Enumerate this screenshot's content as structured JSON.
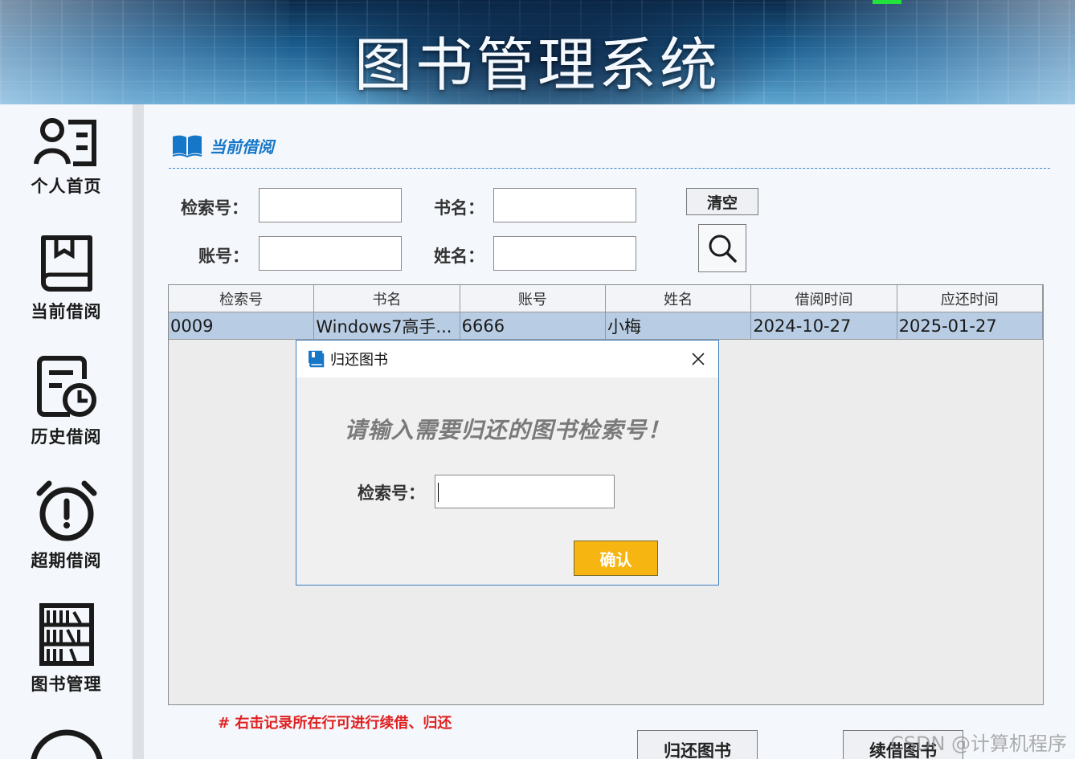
{
  "app": {
    "title": "图书管理系统"
  },
  "sidebar": {
    "items": [
      {
        "label": "个人首页",
        "icon": "user-list-icon"
      },
      {
        "label": "当前借阅",
        "icon": "book-icon"
      },
      {
        "label": "历史借阅",
        "icon": "history-clock-icon"
      },
      {
        "label": "超期借阅",
        "icon": "alarm-clock-icon"
      },
      {
        "label": "图书管理",
        "icon": "bookshelf-icon"
      },
      {
        "label": "",
        "icon": "chat-icon"
      }
    ]
  },
  "section": {
    "title": "当前借阅",
    "icon": "open-book-icon"
  },
  "search": {
    "index_label": "检索号：",
    "title_label": "书名：",
    "account_label": "账号：",
    "name_label": "姓名：",
    "index_value": "",
    "title_value": "",
    "account_value": "",
    "name_value": "",
    "clear_label": "清空",
    "search_icon": "search-icon"
  },
  "table": {
    "columns": [
      "检索号",
      "书名",
      "账号",
      "姓名",
      "借阅时间",
      "应还时间"
    ],
    "rows": [
      [
        "0009",
        "Windows7高手...",
        "6666",
        "小梅",
        "2024-10-27",
        "2025-01-27"
      ]
    ]
  },
  "note": "# 右击记录所在行可进行续借、归还",
  "actions": {
    "return_label": "归还图书",
    "renew_label": "续借图书"
  },
  "dialog": {
    "title": "归还图书",
    "prompt": "请输入需要归还的图书检索号！",
    "field_label": "检索号：",
    "field_value": "",
    "confirm_label": "确认"
  },
  "watermark": "CSDN @计算机程序",
  "colors": {
    "accent": "#1677c8",
    "confirm": "#f6b511",
    "selected_row": "#b8cde3",
    "note": "#e02020"
  }
}
